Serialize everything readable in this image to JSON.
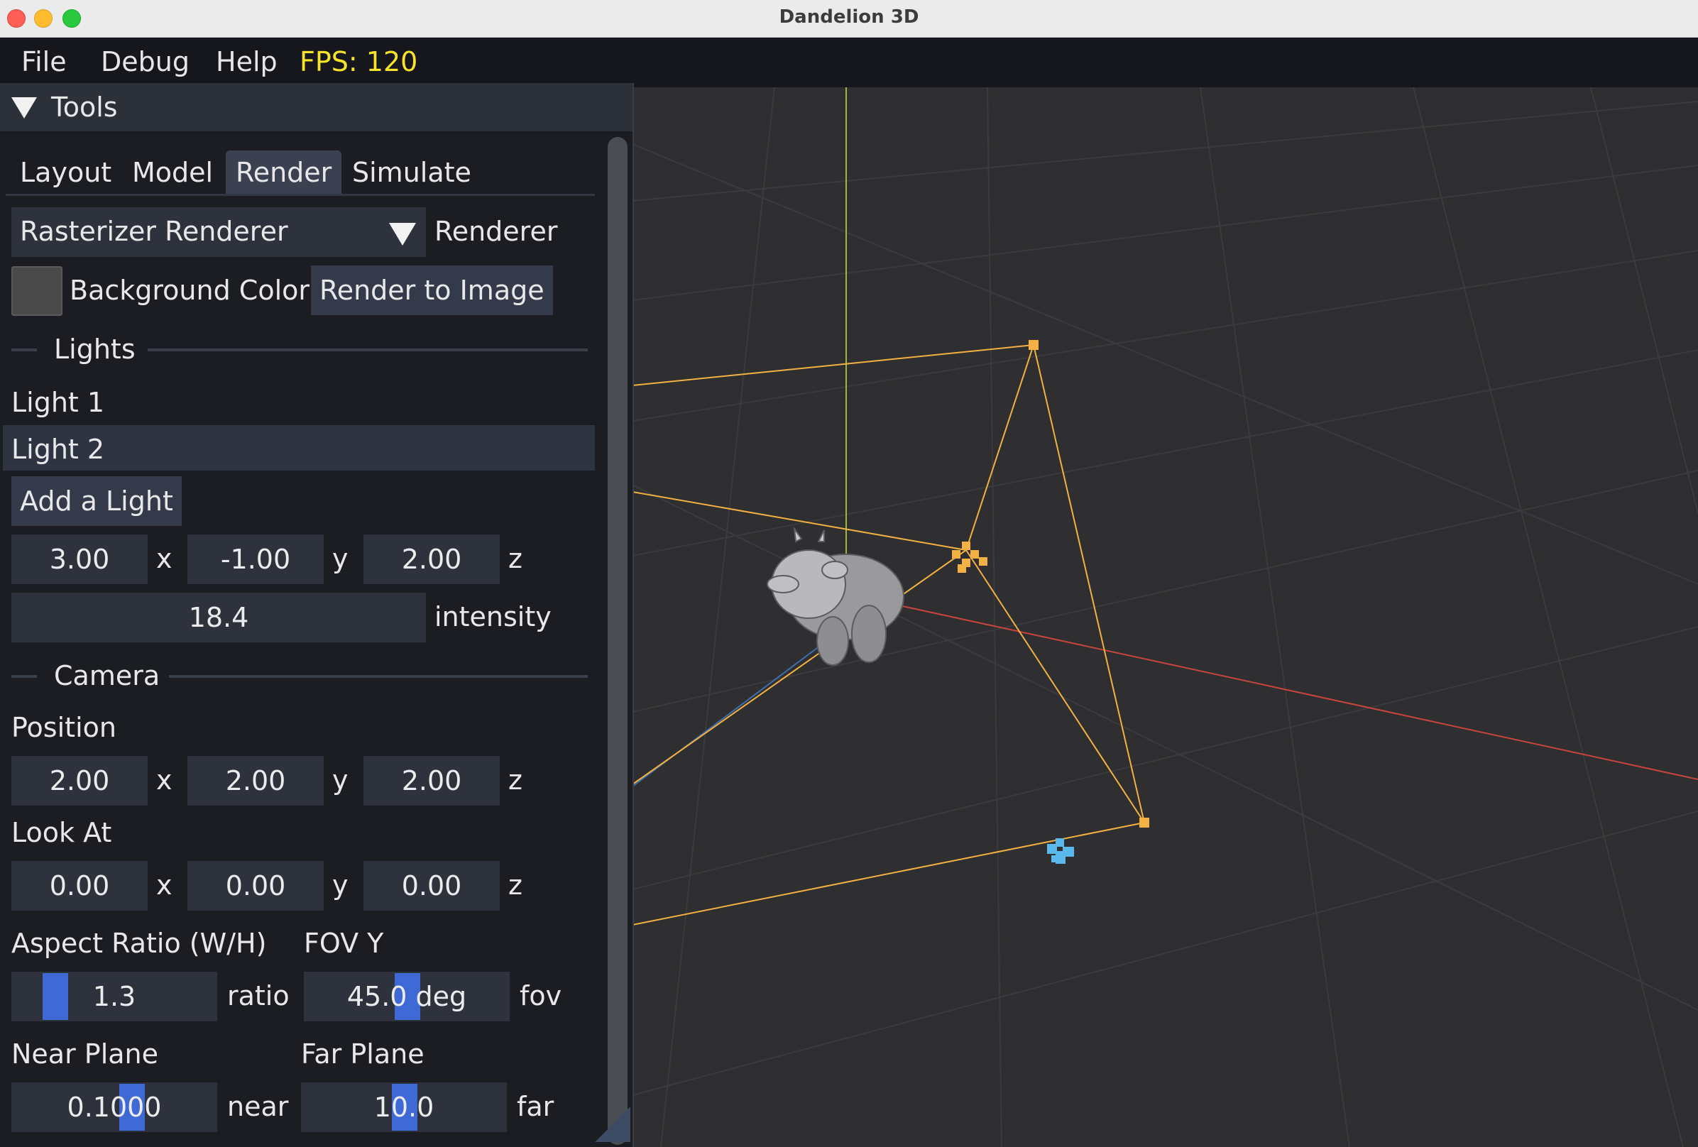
{
  "window": {
    "title": "Dandelion 3D"
  },
  "menubar": {
    "file": "File",
    "debug": "Debug",
    "help": "Help",
    "fps": "FPS: 120"
  },
  "panel": {
    "title": "Tools",
    "tabs": [
      {
        "label": "Layout"
      },
      {
        "label": "Model"
      },
      {
        "label": "Render"
      },
      {
        "label": "Simulate"
      }
    ],
    "active_tab": "Render",
    "renderer": {
      "value": "Rasterizer Renderer",
      "label": "Renderer"
    },
    "background_color": {
      "label": "Background Color",
      "color": "#4a4a4a"
    },
    "render_to_image": "Render to Image",
    "lights": {
      "heading": "Lights",
      "items": [
        {
          "label": "Light 1"
        },
        {
          "label": "Light 2"
        }
      ],
      "selected": "Light 2",
      "add_button": "Add a Light",
      "position": {
        "x": "3.00",
        "y": "-1.00",
        "z": "2.00"
      },
      "axis_labels": {
        "x": "x",
        "y": "y",
        "z": "z"
      },
      "intensity": {
        "value": "18.4",
        "label": "intensity"
      }
    },
    "camera": {
      "heading": "Camera",
      "position_label": "Position",
      "position": {
        "x": "2.00",
        "y": "2.00",
        "z": "2.00"
      },
      "look_at_label": "Look At",
      "look_at": {
        "x": "0.00",
        "y": "0.00",
        "z": "0.00"
      },
      "aspect_ratio": {
        "label": "Aspect Ratio (W/H)",
        "value": "1.3",
        "unit": "ratio"
      },
      "fov_y": {
        "label": "FOV Y",
        "value": "45.0 deg",
        "unit": "fov"
      },
      "near_plane": {
        "label": "Near Plane",
        "value": "0.1000",
        "unit": "near"
      },
      "far_plane": {
        "label": "Far Plane",
        "value": "10.0",
        "unit": "far"
      }
    }
  },
  "colors": {
    "frustum": "#f3b043",
    "axis_x": "#c8453f",
    "axis_y": "#a2b43c",
    "axis_z": "#3d6fb0",
    "light_marker": "#5ab8ec",
    "fps_text": "#f6e32a"
  },
  "icons": {
    "collapse": "triangle-down-icon",
    "combo": "dropdown-arrow-icon",
    "resize": "resize-grip-icon"
  }
}
